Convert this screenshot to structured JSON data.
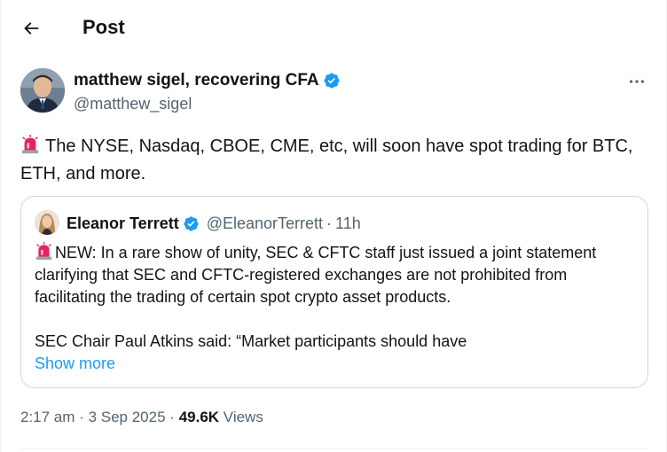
{
  "header": {
    "title": "Post",
    "back_icon": "arrow-left-icon"
  },
  "author": {
    "name": "matthew sigel, recovering CFA",
    "handle": "@matthew_sigel",
    "verified": true
  },
  "post": {
    "emoji": "siren-icon",
    "text": "The NYSE, Nasdaq, CBOE, CME, etc, will soon have spot trading for BTC, ETH, and more."
  },
  "quote": {
    "name": "Eleanor Terrett",
    "handle": "@EleanorTerrett",
    "separator": "·",
    "time": "11h",
    "emoji": "siren-icon",
    "text": "NEW: In a rare show of unity, SEC & CFTC staff just issued a joint statement clarifying that SEC and CFTC-registered exchanges are not prohibited from facilitating the trading of certain spot crypto asset products.",
    "text2": "SEC Chair Paul Atkins said: “Market participants should have",
    "show_more": "Show more"
  },
  "meta": {
    "time": "2:17 am",
    "separator": "·",
    "date": "3 Sep 2025",
    "views_count": "49.6K",
    "views_label": "Views"
  },
  "colors": {
    "accent": "#1d9bf0",
    "secondary_text": "#536471",
    "border": "#cfd9de",
    "siren": "#e0245e"
  }
}
